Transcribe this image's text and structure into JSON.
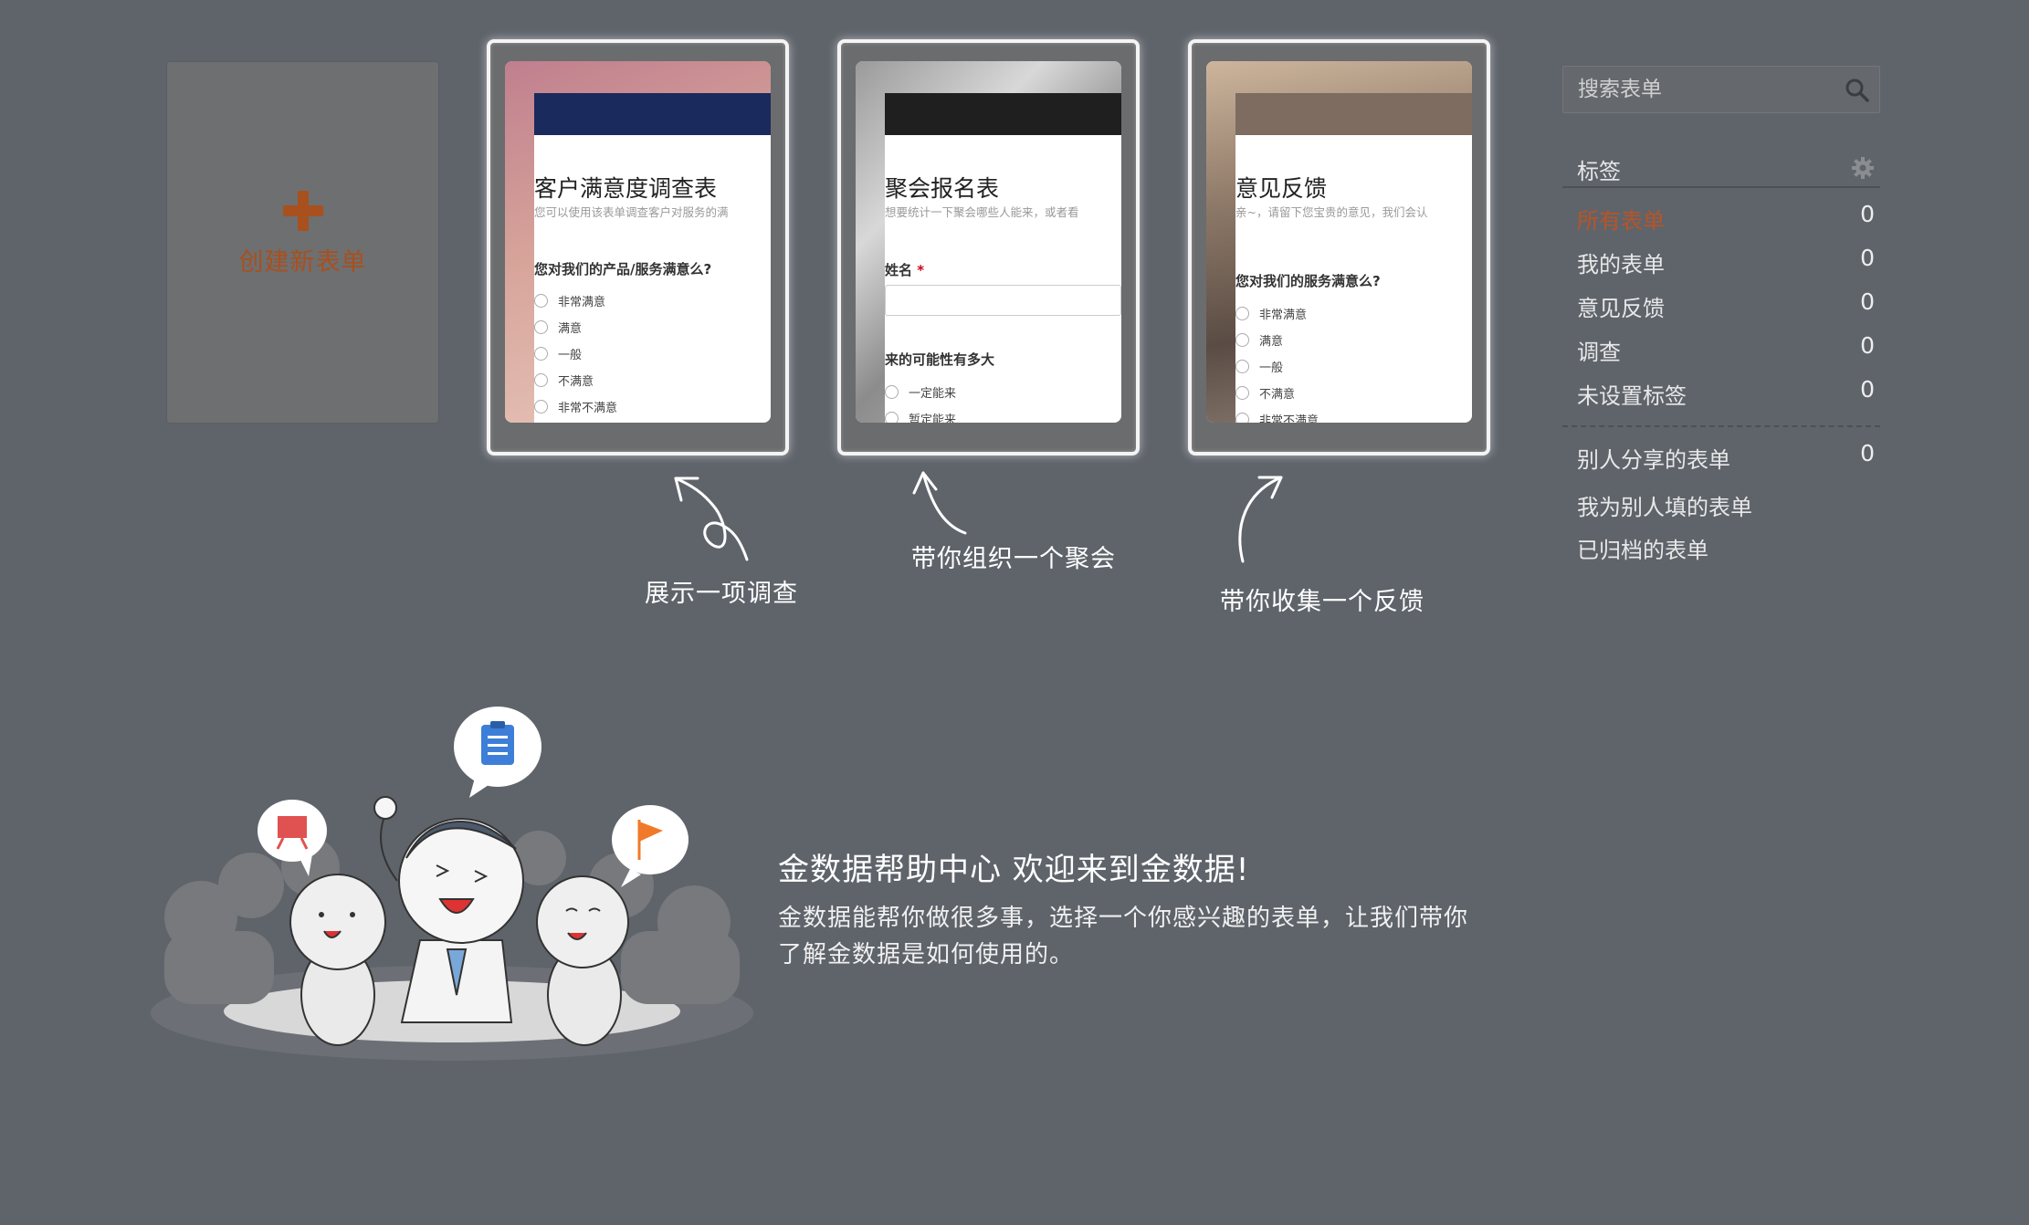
{
  "create": {
    "label": "创建新表单"
  },
  "templates": [
    {
      "title": "客户满意度调查表",
      "desc": "您可以使用该表单调查客户对服务的满",
      "question": "您对我们的产品/服务满意么?",
      "options": [
        "非常满意",
        "满意",
        "一般",
        "不满意",
        "非常不满意"
      ],
      "caption": "展示一项调查",
      "band_color": "#1b2a5c"
    },
    {
      "title": "聚会报名表",
      "desc": "想要统计一下聚会哪些人能来，或者看",
      "field": "姓名",
      "required_mark": "*",
      "question": "来的可能性有多大",
      "options": [
        "一定能来",
        "暂定能来"
      ],
      "caption": "带你组织一个聚会",
      "band_color": "#1f1f1f"
    },
    {
      "title": "意见反馈",
      "desc": "亲~，请留下您宝贵的意见，我们会认",
      "question": "您对我们的服务满意么?",
      "options": [
        "非常满意",
        "满意",
        "一般",
        "不满意",
        "非常不满意"
      ],
      "caption": "带你收集一个反馈",
      "band_color": "#7d6c5f"
    }
  ],
  "search": {
    "placeholder": "搜索表单"
  },
  "tags": {
    "heading": "标签",
    "items": [
      {
        "label": "所有表单",
        "count": "0"
      },
      {
        "label": "我的表单",
        "count": "0"
      },
      {
        "label": "意见反馈",
        "count": "0"
      },
      {
        "label": "调查",
        "count": "0"
      },
      {
        "label": "未设置标签",
        "count": "0"
      }
    ],
    "other": [
      {
        "label": "别人分享的表单",
        "count": "0"
      },
      {
        "label": "我为别人填的表单"
      },
      {
        "label": "已归档的表单"
      }
    ]
  },
  "help": {
    "title": "金数据帮助中心 欢迎来到金数据!",
    "desc": "金数据能帮你做很多事，选择一个你感兴趣的表单，让我们带你了解金数据是如何使用的。"
  },
  "colors": {
    "background": "#5f646b",
    "accent": "#b85426",
    "create_plus": "#a8501e"
  }
}
